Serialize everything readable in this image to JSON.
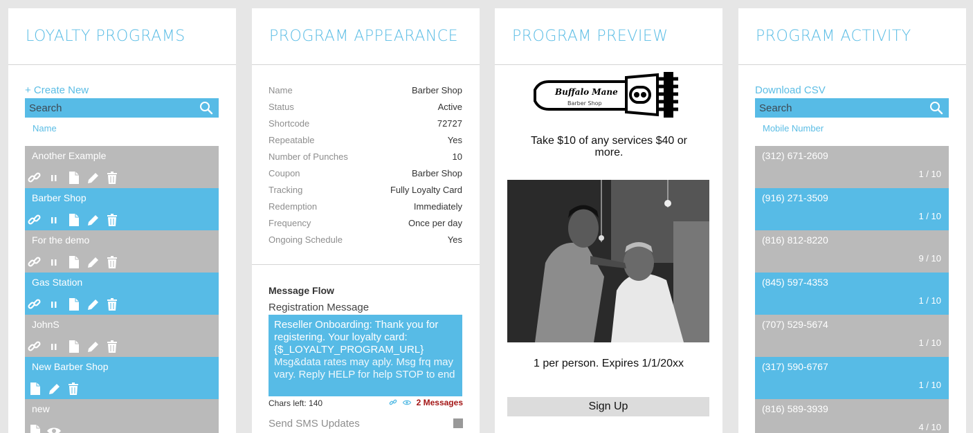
{
  "loyalty": {
    "title": "LOYALTY PROGRAMS",
    "create_new": "+ Create New",
    "search_placeholder": "Search",
    "column": "Name",
    "items": [
      {
        "name": "Another Example"
      },
      {
        "name": "Barber Shop"
      },
      {
        "name": "For the demo"
      },
      {
        "name": "Gas Station"
      },
      {
        "name": "JohnS"
      },
      {
        "name": "New Barber Shop"
      },
      {
        "name": "new"
      }
    ]
  },
  "appearance": {
    "title": "PROGRAM APPEARANCE",
    "fields": [
      {
        "label": "Name",
        "value": "Barber Shop"
      },
      {
        "label": "Status",
        "value": "Active"
      },
      {
        "label": "Shortcode",
        "value": "72727"
      },
      {
        "label": "Repeatable",
        "value": "Yes"
      },
      {
        "label": "Number of Punches",
        "value": "10"
      },
      {
        "label": "Coupon",
        "value": "Barber Shop"
      },
      {
        "label": "Tracking",
        "value": "Fully Loyalty Card"
      },
      {
        "label": "Redemption",
        "value": "Immediately"
      },
      {
        "label": "Frequency",
        "value": "Once per day"
      },
      {
        "label": "Ongoing Schedule",
        "value": "Yes"
      }
    ],
    "message_flow": {
      "title": "Message Flow",
      "registration_label": "Registration Message",
      "message_main": "Reseller Onboarding: Thank you for registering. Your loyalty card: {$_LOYALTY_PROGRAM_URL}",
      "message_footer": "Msg&data rates may aply. Msg frq may vary. Reply HELP for help STOP to end",
      "chars_left": "Chars left: 140",
      "messages": "2 Messages",
      "sms_updates": "Send SMS Updates"
    }
  },
  "preview": {
    "title": "PROGRAM PREVIEW",
    "logo_text": "Buffalo Mane",
    "logo_sub": "Barber Shop",
    "offer": "Take $10 of any services $40 or more.",
    "limit": "1 per person. Expires 1/1/20xx",
    "signup": "Sign Up"
  },
  "activity": {
    "title": "PROGRAM ACTIVITY",
    "download": "Download CSV",
    "search_placeholder": "Search",
    "column": "Mobile Number",
    "rows": [
      {
        "phone": "(312) 671-2609",
        "count": "1 / 10"
      },
      {
        "phone": "(916) 271-3509",
        "count": "1 / 10"
      },
      {
        "phone": "(816) 812-8220",
        "count": "9 / 10"
      },
      {
        "phone": "(845) 597-4353",
        "count": "1 / 10"
      },
      {
        "phone": "(707) 529-5674",
        "count": "1 / 10"
      },
      {
        "phone": "(317) 590-6767",
        "count": "1 / 10"
      },
      {
        "phone": "(816) 589-3939",
        "count": "4 / 10"
      }
    ]
  },
  "colors": {
    "accent": "#5bbde5",
    "list_blue": "#57bbe6",
    "list_gray": "#bababa",
    "messages_red": "#a31515"
  }
}
